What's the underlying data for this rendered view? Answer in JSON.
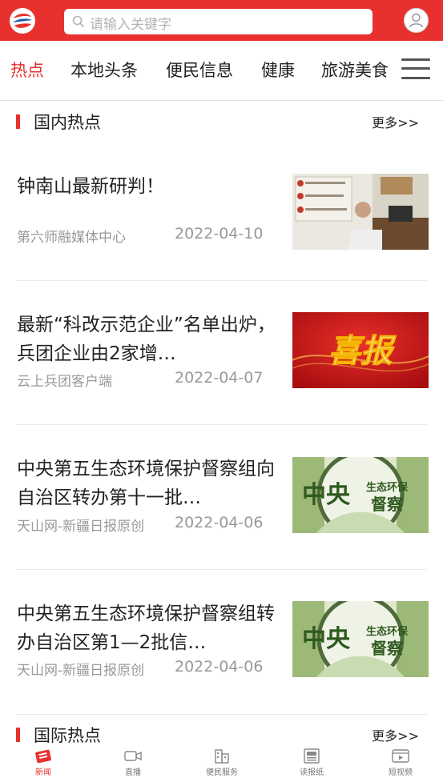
{
  "header": {
    "search_placeholder": "请输入关键字",
    "brand_color": "#e8312e"
  },
  "tabs": [
    {
      "label": "热点",
      "active": true
    },
    {
      "label": "本地头条",
      "active": false
    },
    {
      "label": "便民信息",
      "active": false
    },
    {
      "label": "健康",
      "active": false
    },
    {
      "label": "旅游美食",
      "active": false
    }
  ],
  "sections": [
    {
      "title": "国内热点",
      "more": "更多>>"
    },
    {
      "title": "国际热点",
      "more": "更多>>"
    }
  ],
  "articles": [
    {
      "headline": "钟南山最新研判！",
      "source": "第六师融媒体中心",
      "date": "2022-04-10",
      "thumb": "office-photo"
    },
    {
      "headline": "最新“科改示范企业”名单出炉，兵团企业由2家增…",
      "source": "云上兵团客户端",
      "date": "2022-04-07",
      "thumb_text": "喜报"
    },
    {
      "headline": "中央第五生态环境保护督察组向自治区转办第十一批…",
      "source": "天山网-新疆日报原创",
      "date": "2022-04-06",
      "thumb_text_main": "中央",
      "thumb_text_top": "生态环保",
      "thumb_text_bottom": "督察"
    },
    {
      "headline": "中央第五生态环境保护督察组转办自治区第1—2批信…",
      "source": "天山网-新疆日报原创",
      "date": "2022-04-06",
      "thumb_text_main": "中央",
      "thumb_text_top": "生态环保",
      "thumb_text_bottom": "督察"
    }
  ],
  "bottom_nav": [
    {
      "label": "新闻",
      "icon": "newspaper-icon",
      "active": true
    },
    {
      "label": "直播",
      "icon": "video-camera-icon",
      "active": false
    },
    {
      "label": "便民服务",
      "icon": "buildings-icon",
      "active": false
    },
    {
      "label": "读报纸",
      "icon": "newspaper-read-icon",
      "active": false
    },
    {
      "label": "短视频",
      "icon": "play-video-icon",
      "active": false
    }
  ]
}
